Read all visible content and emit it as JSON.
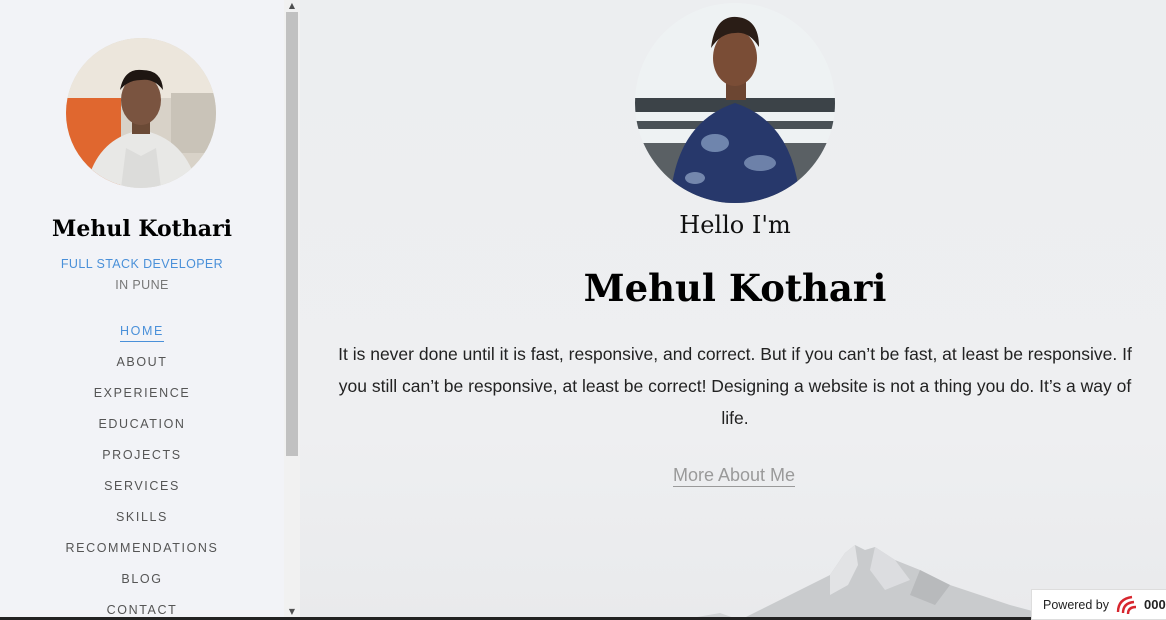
{
  "sidebar": {
    "name": "Mehul Kothari",
    "role": "FULL STACK DEVELOPER",
    "location": "IN PUNE",
    "nav": [
      {
        "label": "HOME",
        "active": true
      },
      {
        "label": "ABOUT"
      },
      {
        "label": "EXPERIENCE"
      },
      {
        "label": "EDUCATION"
      },
      {
        "label": "PROJECTS"
      },
      {
        "label": "SERVICES"
      },
      {
        "label": "SKILLS"
      },
      {
        "label": "RECOMMENDATIONS"
      },
      {
        "label": "BLOG"
      },
      {
        "label": "CONTACT"
      }
    ]
  },
  "main": {
    "greeting": "Hello I'm",
    "name": "Mehul Kothari",
    "bio": "It is never done until it is fast, responsive, and correct. But if you can’t be fast, at least be responsive. If you still can’t be responsive, at least be correct! Designing a website is not a thing you do. It’s a way of life.",
    "more_link": "More About Me"
  },
  "badge": {
    "powered_by": "Powered by",
    "brand": "000"
  },
  "colors": {
    "accent": "#4a90d9",
    "sidebar_bg": "#f2f3f7",
    "muted_link": "#9a9a9a"
  }
}
